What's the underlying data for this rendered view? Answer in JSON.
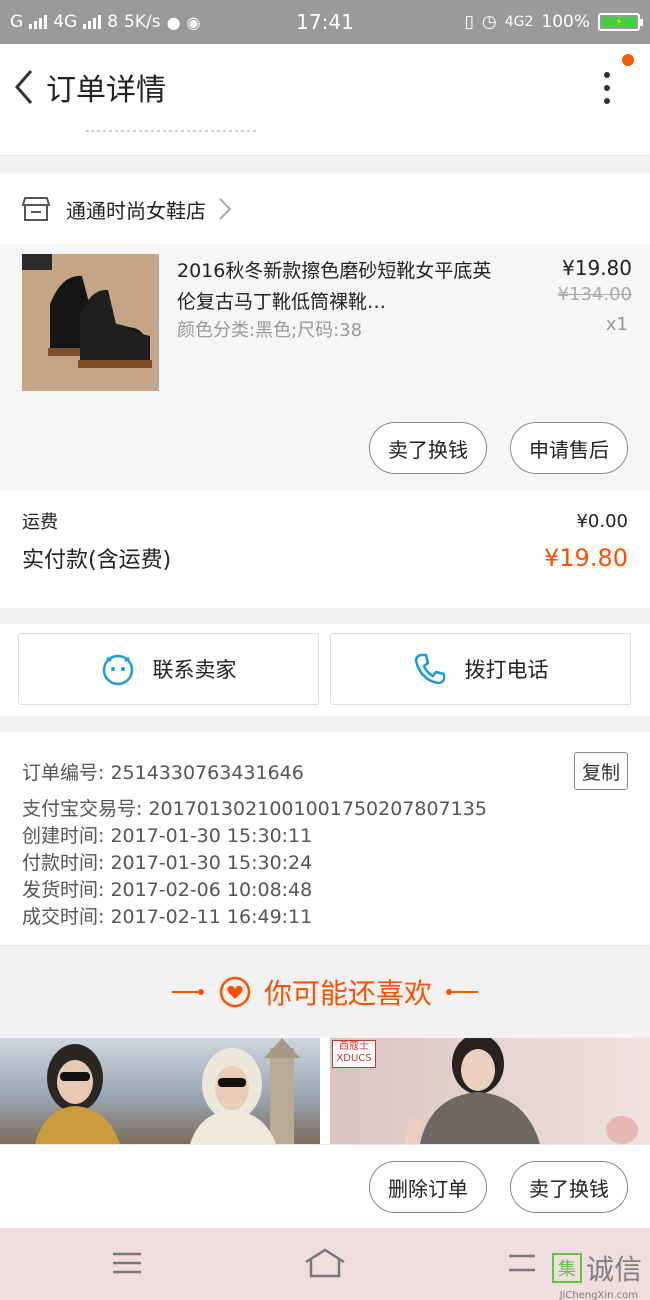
{
  "status_bar": {
    "carrier": "G",
    "network_1": "4G",
    "sim_2": "8",
    "speed": "5K/s",
    "time": "17:41",
    "network_2": "4G2",
    "battery": "100%"
  },
  "header": {
    "title": "订单详情"
  },
  "shop": {
    "name": "通通时尚女鞋店"
  },
  "product": {
    "title": "2016秋冬新款擦色磨砂短靴女平底英伦复古马丁靴低筒裸靴…",
    "sku": "颜色分类:黑色;尺码:38",
    "price": "¥19.80",
    "original_price": "¥134.00",
    "quantity": "x1"
  },
  "item_actions": {
    "sell": "卖了换钱",
    "after_sales": "申请售后"
  },
  "fees": {
    "shipping_label": "运费",
    "shipping_value": "¥0.00",
    "paid_label": "实付款(含运费)",
    "paid_value": "¥19.80"
  },
  "contact": {
    "seller_label": "联系卖家",
    "call_label": "拨打电话"
  },
  "order_info": {
    "order_no": "订单编号: 2514330763431646",
    "copy": "复制",
    "alipay_no": "支付宝交易号: 2017013021001001750207807135",
    "created": "创建时间: 2017-01-30  15:30:11",
    "paid": "付款时间: 2017-01-30  15:30:24",
    "shipped": "发货时间: 2017-02-06  10:08:48",
    "completed": "成交时间: 2017-02-11  16:49:11"
  },
  "recommend": {
    "title": "你可能还喜欢",
    "brand_text": "西蔻士 XDUCS"
  },
  "bottom_actions": {
    "delete": "删除订单",
    "sell": "卖了换钱"
  },
  "watermark": {
    "main": "诚信",
    "logo_char": "集",
    "url": "JiChengXin.com"
  },
  "colors": {
    "accent": "#ff5000",
    "status_bar": "#9a9a9a",
    "icon_blue": "#1e9ad6"
  }
}
